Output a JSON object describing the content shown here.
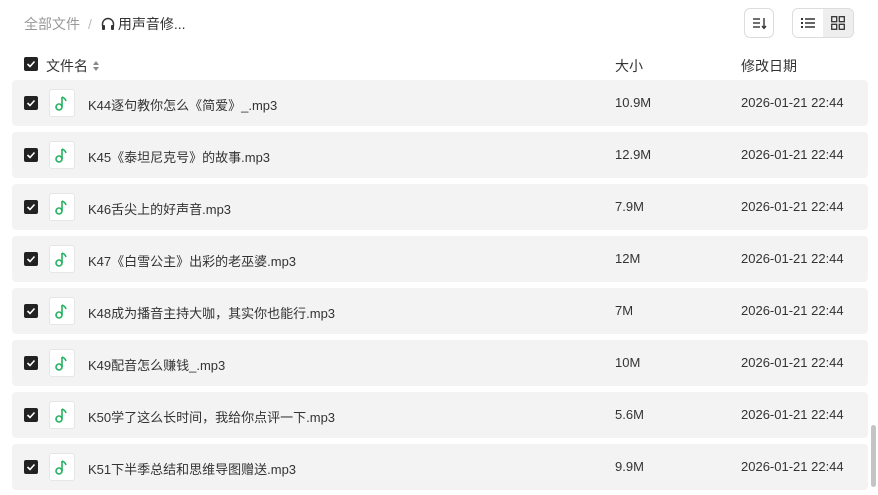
{
  "breadcrumb": {
    "root": "全部文件",
    "separator": "/",
    "current": "用声音修..."
  },
  "icons": {
    "folder": "headphones-icon",
    "file": "music-note-icon",
    "sort": "sort-icon",
    "list": "list-view-icon",
    "grid": "grid-view-icon"
  },
  "colors": {
    "accent": "#22b35e",
    "checkbox": "#222222",
    "row_bg": "#f3f3f3"
  },
  "header": {
    "name": "文件名",
    "size": "大小",
    "date": "修改日期",
    "all_checked": true
  },
  "files": [
    {
      "name": "K44逐句教你怎么《简爱》_.mp3",
      "size": "10.9M",
      "date": "2026-01-21 22:44",
      "checked": true
    },
    {
      "name": "K45《泰坦尼克号》的故事.mp3",
      "size": "12.9M",
      "date": "2026-01-21 22:44",
      "checked": true
    },
    {
      "name": "K46舌尖上的好声音.mp3",
      "size": "7.9M",
      "date": "2026-01-21 22:44",
      "checked": true
    },
    {
      "name": "K47《白雪公主》出彩的老巫婆.mp3",
      "size": "12M",
      "date": "2026-01-21 22:44",
      "checked": true
    },
    {
      "name": "K48成为播音主持大咖，其实你也能行.mp3",
      "size": "7M",
      "date": "2026-01-21 22:44",
      "checked": true
    },
    {
      "name": "K49配音怎么赚钱_.mp3",
      "size": "10M",
      "date": "2026-01-21 22:44",
      "checked": true
    },
    {
      "name": "K50学了这么长时间，我给你点评一下.mp3",
      "size": "5.6M",
      "date": "2026-01-21 22:44",
      "checked": true
    },
    {
      "name": "K51下半季总结和思维导图赠送.mp3",
      "size": "9.9M",
      "date": "2026-01-21 22:44",
      "checked": true
    }
  ]
}
